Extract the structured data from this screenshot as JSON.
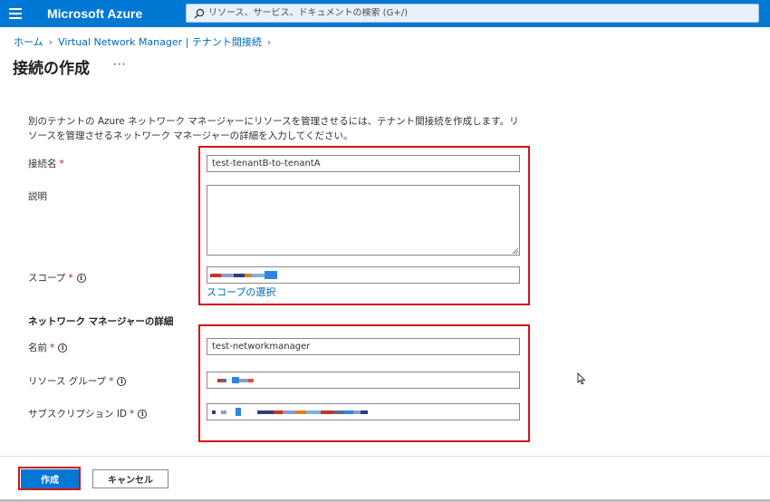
{
  "header": {
    "brand": "Microsoft Azure",
    "search_placeholder": "リソース、サービス、ドキュメントの検索 (G+/)"
  },
  "breadcrumb": {
    "items": [
      "ホーム",
      "Virtual Network Manager | テナント間接続"
    ]
  },
  "page": {
    "title": "接続の作成",
    "more": "···",
    "description": "別のテナントの Azure ネットワーク マネージャーにリソースを管理させるには、テナント間接続を作成します。リソースを管理させるネットワーク マネージャーの詳細を入力してください。"
  },
  "form": {
    "connection_name_label": "接続名",
    "connection_name_value": "test-tenantB-to-tenantA",
    "description_label": "説明",
    "description_value": "",
    "scope_label": "スコープ",
    "scope_link": "スコープの選択",
    "required_marker": "*",
    "info_glyph": "i",
    "section_heading": "ネットワーク マネージャーの詳細",
    "name_label": "名前",
    "name_value": "test-networkmanager",
    "resource_group_label": "リソース グループ",
    "subscription_label": "サブスクリプション ID"
  },
  "actions": {
    "create": "作成",
    "cancel": "キャンセル"
  },
  "colors": {
    "accent": "#0078d4",
    "highlight": "#d4121b",
    "link": "#0067b8"
  }
}
